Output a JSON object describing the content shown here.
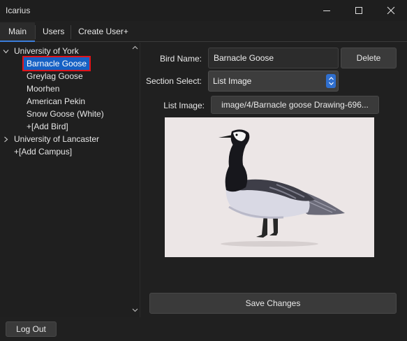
{
  "window": {
    "title": "Icarius",
    "controls": [
      "minimize-icon",
      "maximize-icon",
      "close-icon"
    ]
  },
  "tabs": [
    {
      "label": "Main",
      "active": true
    },
    {
      "label": "Users",
      "active": false
    },
    {
      "label": "Create User+",
      "active": false
    }
  ],
  "tree": {
    "campuses": [
      {
        "label": "University of York",
        "expanded": true,
        "birds": [
          "Barnacle Goose",
          "Greylag Goose",
          "Moorhen",
          "American Pekin",
          "Snow Goose (White)"
        ],
        "selected": "Barnacle Goose",
        "add_bird": "+[Add Bird]"
      },
      {
        "label": "University of Lancaster",
        "expanded": false
      }
    ],
    "add_campus": "+[Add Campus]"
  },
  "form": {
    "bird_name_label": "Bird Name:",
    "bird_name_value": "Barnacle Goose",
    "delete_label": "Delete",
    "section_select_label": "Section Select:",
    "section_select_value": "List Image",
    "list_image_label": "List Image:",
    "list_image_path": "image/4/Barnacle goose Drawing-696...",
    "save_label": "Save Changes"
  },
  "footer": {
    "logout_label": "Log Out"
  },
  "colors": {
    "accent": "#3b7ddb",
    "selection": "#1560c4",
    "selection_outline": "#e0141c",
    "background": "#202020"
  }
}
